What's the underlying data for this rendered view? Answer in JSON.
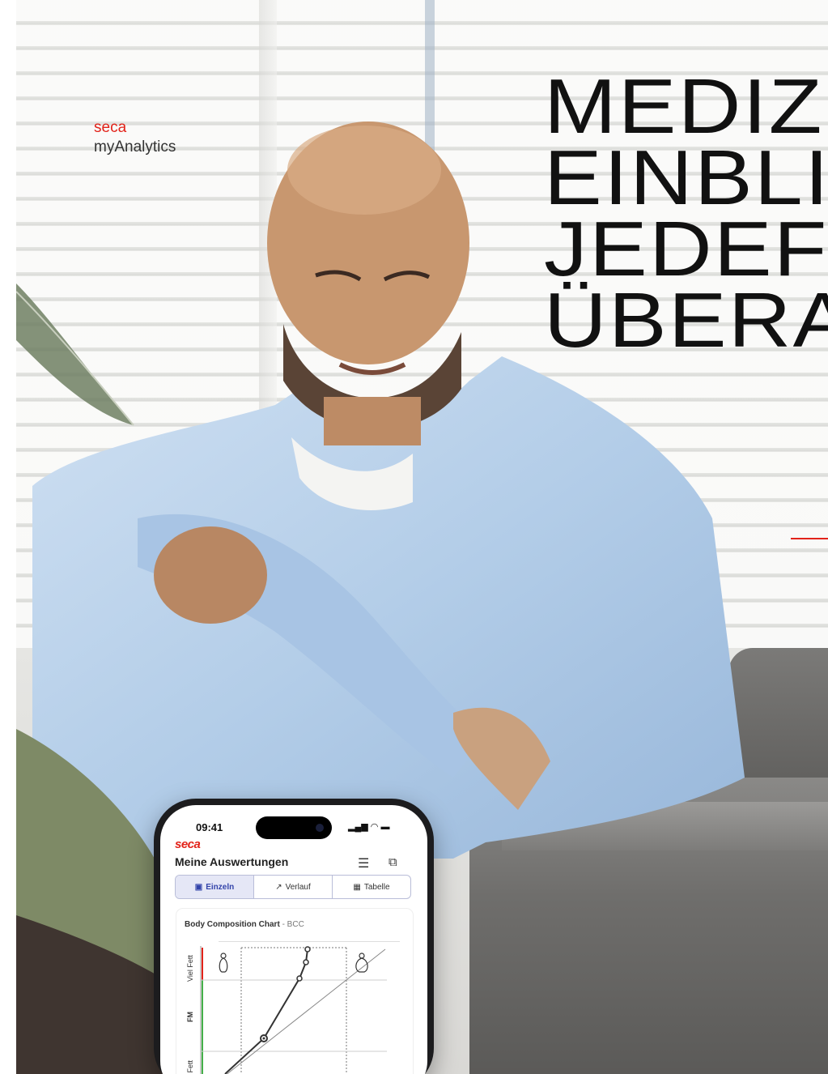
{
  "brand": {
    "company": "seca",
    "product": "myAnalytics"
  },
  "headline": {
    "lines": [
      "MEDIZ",
      "EINBLI",
      "JEDEF",
      "ÜBERA"
    ]
  },
  "colors": {
    "accent": "#e2231a",
    "text": "#111111"
  },
  "phone": {
    "time": "09:41",
    "status_icons": [
      "signal-icon",
      "wifi-icon",
      "battery-icon"
    ],
    "app_logo": "seca",
    "screen_title": "Meine Auswertungen",
    "header_icons": [
      "filter-icon",
      "copy-icon"
    ],
    "tabs": [
      {
        "label": "Einzeln",
        "icon": "chart-icon",
        "active": true
      },
      {
        "label": "Verlauf",
        "icon": "trend-icon",
        "active": false
      },
      {
        "label": "Tabelle",
        "icon": "table-icon",
        "active": false
      }
    ],
    "card": {
      "title": "Body Composition Chart",
      "subtitle": "- BCC",
      "y_axis_labels": [
        "Viel Fett",
        "FM",
        "ig Fett"
      ]
    }
  }
}
